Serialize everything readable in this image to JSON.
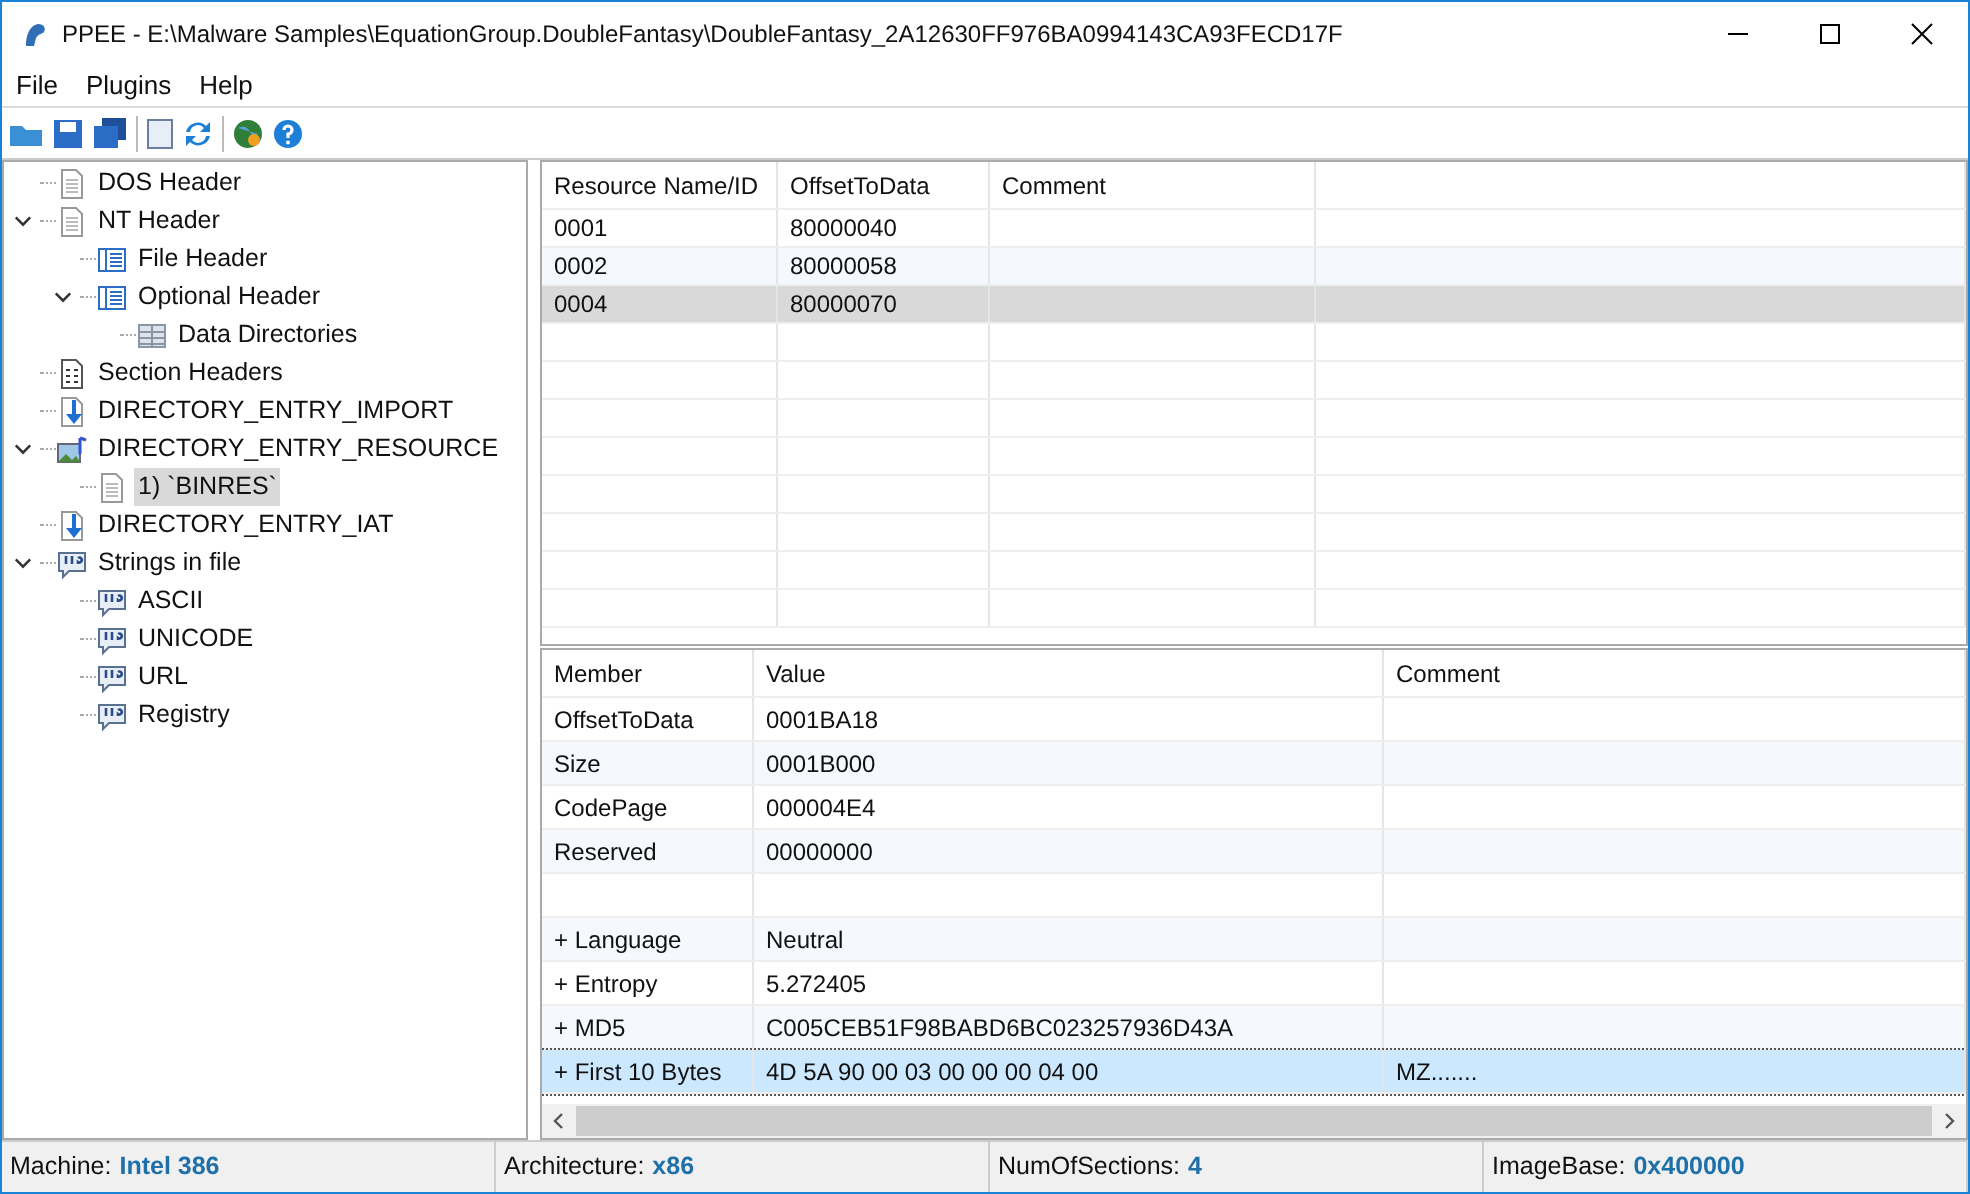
{
  "window": {
    "title": "PPEE - E:\\Malware Samples\\EquationGroup.DoubleFantasy\\DoubleFantasy_2A12630FF976BA0994143CA93FECD17F"
  },
  "menu": [
    "File",
    "Plugins",
    "Help"
  ],
  "tree": [
    {
      "label": "DOS Header",
      "kind": "page",
      "selected": false
    },
    {
      "label": "NT Header",
      "kind": "page",
      "selected": false,
      "expanded": true,
      "children": [
        {
          "label": "File Header",
          "kind": "table",
          "selected": false
        },
        {
          "label": "Optional Header",
          "kind": "table",
          "selected": false,
          "expanded": true,
          "children": [
            {
              "label": "Data Directories",
              "kind": "grid",
              "selected": false
            }
          ]
        }
      ]
    },
    {
      "label": "Section Headers",
      "kind": "section",
      "selected": false
    },
    {
      "label": "DIRECTORY_ENTRY_IMPORT",
      "kind": "import",
      "selected": false
    },
    {
      "label": "DIRECTORY_ENTRY_RESOURCE",
      "kind": "resource",
      "selected": false,
      "expanded": true,
      "children": [
        {
          "label": "1) `BINRES`",
          "kind": "page",
          "selected": true
        }
      ]
    },
    {
      "label": "DIRECTORY_ENTRY_IAT",
      "kind": "import",
      "selected": false
    },
    {
      "label": "Strings in file",
      "kind": "strings",
      "selected": false,
      "expanded": true,
      "children": [
        {
          "label": "ASCII",
          "kind": "strings",
          "selected": false
        },
        {
          "label": "UNICODE",
          "kind": "strings",
          "selected": false
        },
        {
          "label": "URL",
          "kind": "strings",
          "selected": false
        },
        {
          "label": "Registry",
          "kind": "strings",
          "selected": false
        }
      ]
    }
  ],
  "resource_table": {
    "columns": [
      "Resource Name/ID",
      "OffsetToData",
      "Comment"
    ],
    "rows": [
      {
        "cells": [
          "0001",
          "80000040",
          ""
        ],
        "selected": false
      },
      {
        "cells": [
          "0002",
          "80000058",
          ""
        ],
        "selected": false
      },
      {
        "cells": [
          "0004",
          "80000070",
          ""
        ],
        "selected": true
      }
    ]
  },
  "member_table": {
    "columns": [
      "Member",
      "Value",
      "Comment"
    ],
    "rows": [
      {
        "cells": [
          "OffsetToData",
          "0001BA18",
          ""
        ],
        "selected": false
      },
      {
        "cells": [
          "Size",
          "0001B000",
          ""
        ],
        "selected": false
      },
      {
        "cells": [
          "CodePage",
          "000004E4",
          ""
        ],
        "selected": false
      },
      {
        "cells": [
          "Reserved",
          "00000000",
          ""
        ],
        "selected": false
      },
      {
        "cells": [
          "",
          "",
          ""
        ],
        "selected": false
      },
      {
        "cells": [
          "+ Language",
          "Neutral",
          ""
        ],
        "selected": false
      },
      {
        "cells": [
          "+ Entropy",
          "5.272405",
          ""
        ],
        "selected": false
      },
      {
        "cells": [
          "+ MD5",
          "C005CEB51F98BABD6BC023257936D43A",
          ""
        ],
        "selected": false
      },
      {
        "cells": [
          "+ First 10 Bytes",
          "4D 5A 90 00 03 00 00 00 04 00",
          "MZ......."
        ],
        "selected": true
      }
    ]
  },
  "status_bar": [
    {
      "label": "Machine:",
      "value": "Intel 386"
    },
    {
      "label": "Architecture:",
      "value": "x86"
    },
    {
      "label": "NumOfSections:",
      "value": "4"
    },
    {
      "label": "ImageBase:",
      "value": "0x400000"
    }
  ]
}
